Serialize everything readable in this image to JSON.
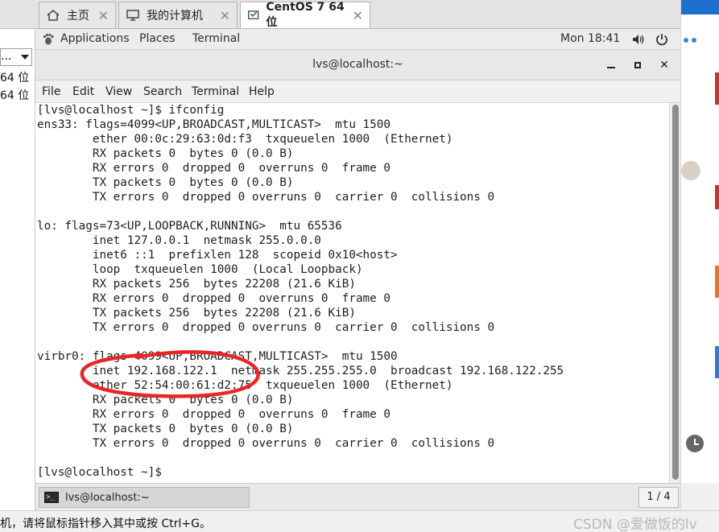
{
  "vm_tabs": [
    {
      "label": "主页",
      "icon": "home-icon",
      "active": false
    },
    {
      "label": "我的计算机",
      "icon": "computer-icon",
      "active": false
    },
    {
      "label": "CentOS 7 64 位",
      "icon": "vm-icon",
      "active": true
    }
  ],
  "host_left": {
    "combo_value": "...",
    "items": [
      "64 位",
      "64 位"
    ]
  },
  "gnome_topbar": {
    "applications": "Applications",
    "places": "Places",
    "terminal": "Terminal",
    "clock": "Mon 18:41",
    "volume_icon": "volume-icon",
    "power_icon": "power-icon"
  },
  "terminal": {
    "title": "lvs@localhost:~",
    "menu": [
      "File",
      "Edit",
      "View",
      "Search",
      "Terminal",
      "Help"
    ],
    "lines": [
      "[lvs@localhost ~]$ ifconfig",
      "ens33: flags=4099<UP,BROADCAST,MULTICAST>  mtu 1500",
      "        ether 00:0c:29:63:0d:f3  txqueuelen 1000  (Ethernet)",
      "        RX packets 0  bytes 0 (0.0 B)",
      "        RX errors 0  dropped 0  overruns 0  frame 0",
      "        TX packets 0  bytes 0 (0.0 B)",
      "        TX errors 0  dropped 0 overruns 0  carrier 0  collisions 0",
      "",
      "lo: flags=73<UP,LOOPBACK,RUNNING>  mtu 65536",
      "        inet 127.0.0.1  netmask 255.0.0.0",
      "        inet6 ::1  prefixlen 128  scopeid 0x10<host>",
      "        loop  txqueuelen 1000  (Local Loopback)",
      "        RX packets 256  bytes 22208 (21.6 KiB)",
      "        RX errors 0  dropped 0  overruns 0  frame 0",
      "        TX packets 256  bytes 22208 (21.6 KiB)",
      "        TX errors 0  dropped 0 overruns 0  carrier 0  collisions 0",
      "",
      "virbr0: flags=4099<UP,BROADCAST,MULTICAST>  mtu 1500",
      "        inet 192.168.122.1  netmask 255.255.255.0  broadcast 192.168.122.255",
      "        ether 52:54:00:61:d2:75  txqueuelen 1000  (Ethernet)",
      "        RX packets 0  bytes 0 (0.0 B)",
      "        RX errors 0  dropped 0  overruns 0  frame 0",
      "        TX packets 0  bytes 0 (0.0 B)",
      "        TX errors 0  dropped 0 overruns 0  carrier 0  collisions 0",
      "",
      "[lvs@localhost ~]$"
    ]
  },
  "window_list": {
    "task_label": "lvs@localhost:~",
    "pager": "1 / 4"
  },
  "host_status": {
    "text": "机，请将鼠标指针移入其中或按 Ctrl+G。",
    "watermark": "CSDN @爱做饭的lv"
  },
  "colors": {
    "annotation": "#e8262a"
  }
}
